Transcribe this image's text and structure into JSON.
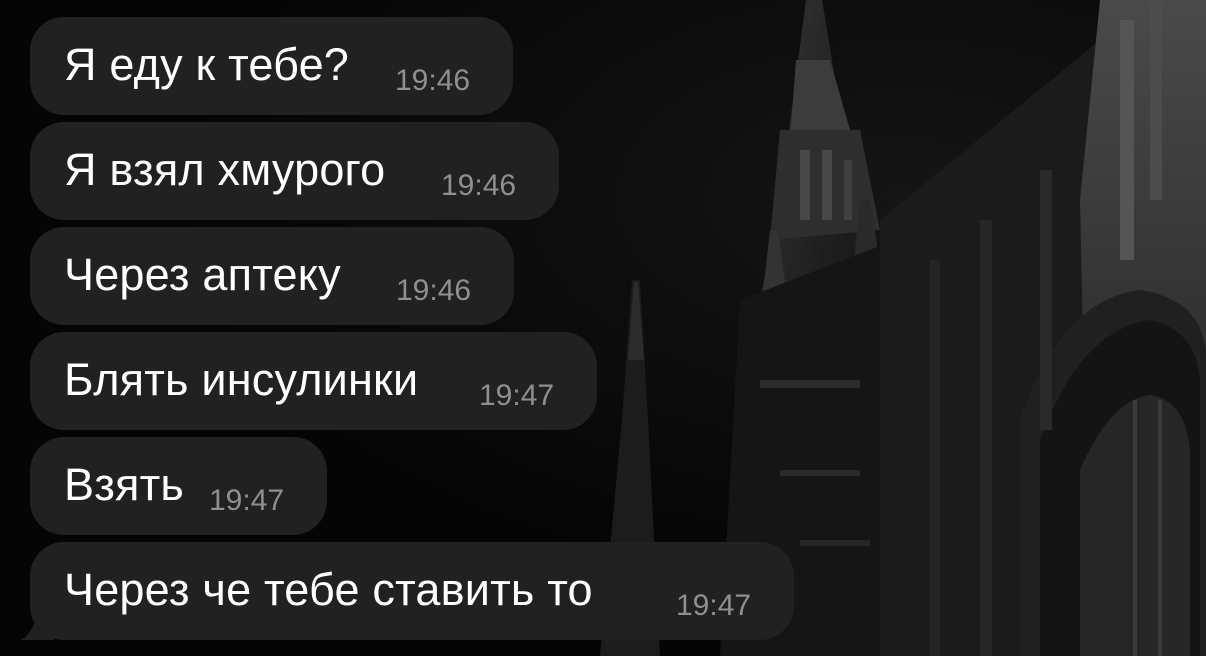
{
  "colors": {
    "bubble_background": "#212121",
    "message_text": "#ffffff",
    "timestamp_text": "#8e8e93",
    "wallpaper": "#060606"
  },
  "messages": [
    {
      "text": "Я еду к тебе?",
      "time": "19:46"
    },
    {
      "text": "Я взял хмурого",
      "time": "19:46"
    },
    {
      "text": "Через аптеку",
      "time": "19:46"
    },
    {
      "text": "Блять инсулинки",
      "time": "19:47"
    },
    {
      "text": "Взять",
      "time": "19:47"
    },
    {
      "text": "Через че тебе ставить то",
      "time": "19:47"
    }
  ]
}
